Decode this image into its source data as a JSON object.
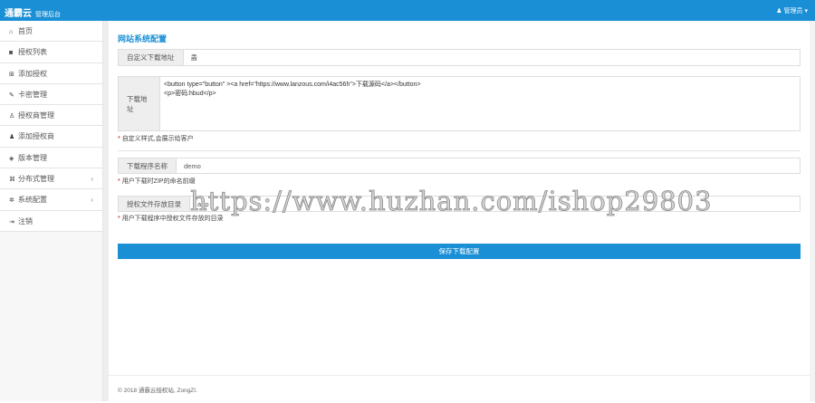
{
  "header": {
    "brand": "通霸云",
    "subtitle": "管理后台",
    "user": "管理员"
  },
  "sidebar": {
    "items": [
      {
        "icon": "home-icon",
        "glyph": "⌂",
        "label": "首页"
      },
      {
        "icon": "shield-icon",
        "glyph": "◙",
        "label": "授权列表"
      },
      {
        "icon": "plus-square-icon",
        "glyph": "⊞",
        "label": "添加授权"
      },
      {
        "icon": "edit-icon",
        "glyph": "✎",
        "label": "卡密管理"
      },
      {
        "icon": "user-icon",
        "glyph": "♙",
        "label": "授权商管理"
      },
      {
        "icon": "user-plus-icon",
        "glyph": "♟",
        "label": "添加授权商"
      },
      {
        "icon": "tag-icon",
        "glyph": "◈",
        "label": "版本管理"
      },
      {
        "icon": "sitemap-icon",
        "glyph": "⌘",
        "label": "分布式管理",
        "chevron": "›"
      },
      {
        "icon": "gear-icon",
        "glyph": "✲",
        "label": "系统配置",
        "chevron": "›"
      },
      {
        "icon": "sign-out-icon",
        "glyph": "⇥",
        "label": "注销"
      }
    ]
  },
  "main": {
    "title": "网站系统配置",
    "custom_url": {
      "label": "自定义下载地址",
      "value": "蛊"
    },
    "download": {
      "label": "下载地址",
      "value": "<button type=\"button\" ><a href=\"https://www.lanzous.com/i4ac56h\">下载源码</a></button>\n<p>密码:hbud</p>",
      "hint": "自定义样式,会展示给客户"
    },
    "program_name": {
      "label": "下载程序名称",
      "value": "demo",
      "hint": "用户下载时ZIP的命名前缀"
    },
    "auth_dir": {
      "label": "授权文件存放目录",
      "value": "app",
      "hint": "用户下载程序中授权文件存放的目录"
    },
    "save_label": "保存下载配置",
    "footer": "© 2018 通霸云授权站, ZongZI."
  },
  "watermark": "https://www.huzhan.com/ishop29803"
}
